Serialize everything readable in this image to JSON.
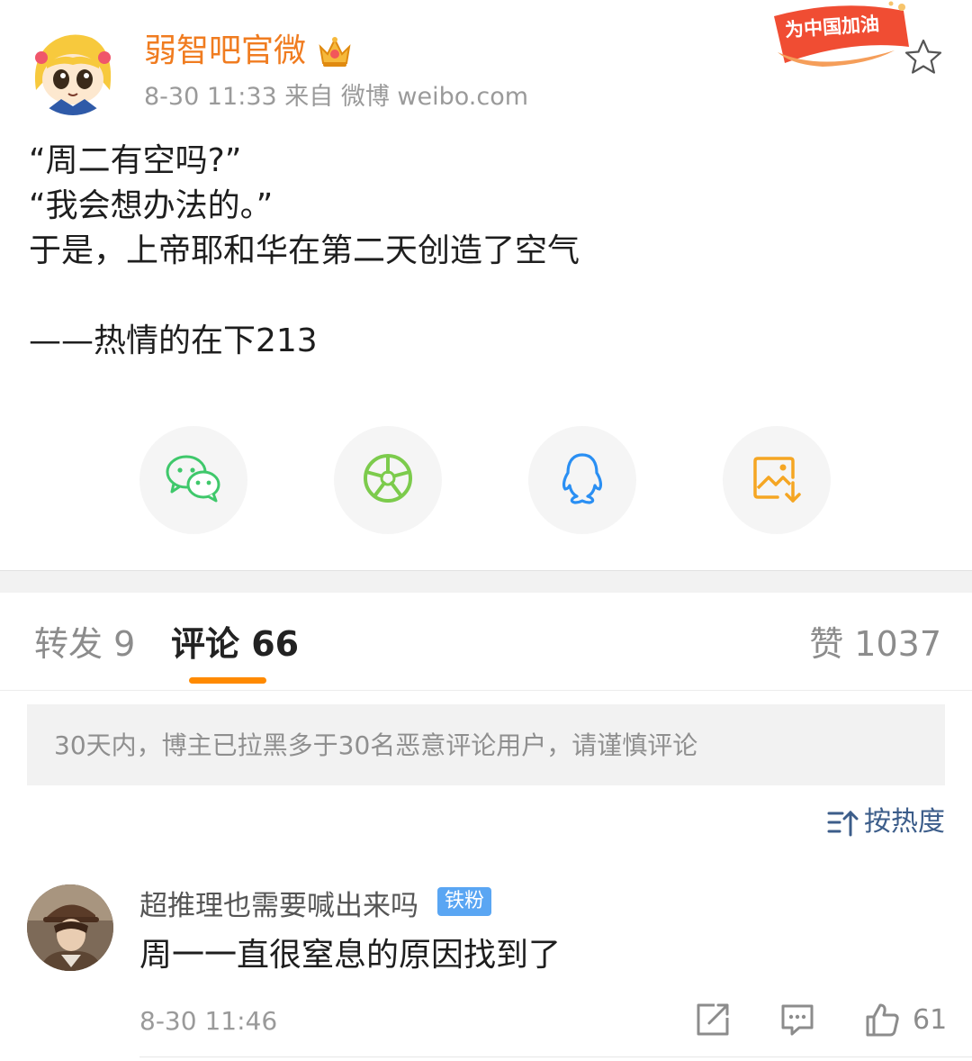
{
  "post": {
    "author": "弱智吧官微",
    "meta": "8-30 11:33  来自 微博 weibo.com",
    "badge_label": "为中国加油",
    "lines": [
      "“周二有空吗?”",
      "“我会想办法的。”",
      "于是，上帝耶和华在第二天创造了空气",
      "",
      "——热情的在下213"
    ]
  },
  "share": {
    "icons": [
      "wechat-icon",
      "moments-icon",
      "qq-icon",
      "save-image-icon"
    ],
    "colors": {
      "wechat": "#3fc86b",
      "moments": "#7ccb4c",
      "qq": "#2a8ff3",
      "save": "#f5a623"
    }
  },
  "tabs": {
    "repost": "转发 9",
    "comments": "评论 66",
    "likes": "赞 1037"
  },
  "notice": "30天内，博主已拉黑多于30名恶意评论用户，请谨慎评论",
  "sort_label": "按热度",
  "comment": {
    "name": "超推理也需要喊出来吗",
    "badge": "铁粉",
    "text": "周一一直很窒息的原因找到了",
    "time": "8-30 11:46",
    "likes": "61"
  },
  "colors": {
    "accent": "#ff8a00",
    "author": "#f07c20",
    "link": "#3c5d8a"
  }
}
